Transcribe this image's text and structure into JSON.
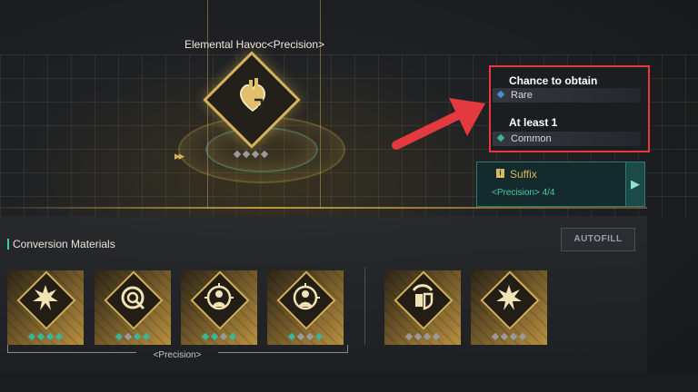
{
  "item": {
    "title": "Elemental Havoc<Precision>",
    "icon": "mechanical-heart-icon"
  },
  "popup": {
    "chance_label": "Chance to obtain",
    "chance_value": "Rare",
    "chance_color": "#4a8fd6",
    "minimum_label": "At least 1",
    "minimum_value": "Common",
    "minimum_color": "#3bb59a"
  },
  "suffix": {
    "title": "Suffix",
    "subtitle": "<Precision>  4/4",
    "icon": "info-icon",
    "next_icon": "chevron-right-icon"
  },
  "materials": {
    "title": "Conversion Materials",
    "autofill_label": "AUTOFILL",
    "group_label": "<Precision>",
    "cards": [
      {
        "icon": "explosion-icon",
        "ranks": [
          "teal",
          "teal",
          "teal",
          "teal"
        ]
      },
      {
        "icon": "target-ring-icon",
        "ranks": [
          "teal",
          "grey",
          "teal",
          "teal"
        ]
      },
      {
        "icon": "crosshair-figure-icon",
        "ranks": [
          "teal",
          "teal",
          "grey",
          "teal"
        ]
      },
      {
        "icon": "crosshair-figure-icon",
        "ranks": [
          "teal",
          "grey",
          "grey",
          "teal"
        ]
      },
      {
        "icon": "shield-gauge-icon",
        "ranks": [
          "grey",
          "grey",
          "grey",
          "grey"
        ]
      },
      {
        "icon": "explosion-icon",
        "ranks": [
          "grey",
          "grey",
          "grey",
          "grey"
        ]
      }
    ]
  },
  "colors": {
    "accent_gold": "#d8b25a",
    "accent_teal": "#46cba8",
    "highlight_red": "#e53940"
  }
}
